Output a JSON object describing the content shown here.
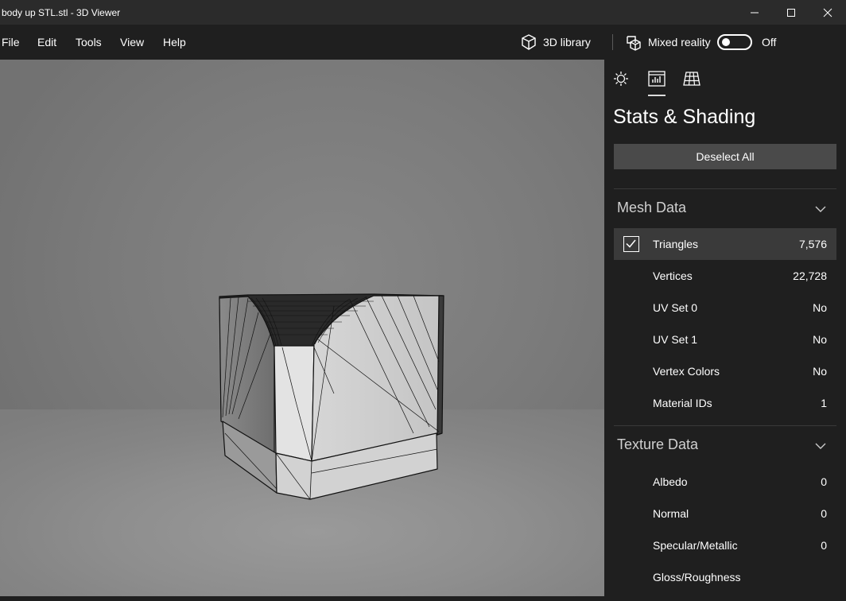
{
  "window": {
    "title": "body up STL.stl - 3D Viewer"
  },
  "menu": {
    "file": "File",
    "edit": "Edit",
    "tools": "Tools",
    "view": "View",
    "help": "Help"
  },
  "toolbar": {
    "library_label": "3D library",
    "mixed_reality_label": "Mixed reality",
    "toggle_state": "Off"
  },
  "panel": {
    "title": "Stats & Shading",
    "deselect_label": "Deselect All",
    "mesh": {
      "header": "Mesh Data",
      "rows": [
        {
          "label": "Triangles",
          "value": "7,576",
          "checked": true
        },
        {
          "label": "Vertices",
          "value": "22,728"
        },
        {
          "label": "UV Set 0",
          "value": "No"
        },
        {
          "label": "UV Set 1",
          "value": "No"
        },
        {
          "label": "Vertex Colors",
          "value": "No"
        },
        {
          "label": "Material IDs",
          "value": "1"
        }
      ]
    },
    "texture": {
      "header": "Texture Data",
      "rows": [
        {
          "label": "Albedo",
          "value": "0"
        },
        {
          "label": "Normal",
          "value": "0"
        },
        {
          "label": "Specular/Metallic",
          "value": "0"
        },
        {
          "label": "Gloss/Roughness",
          "value": ""
        }
      ]
    }
  },
  "icons": {
    "tabs": [
      "lighting-icon",
      "stats-icon",
      "grid-icon"
    ],
    "library": "cube-icon",
    "mixed_reality": "mixed-reality-icon"
  }
}
